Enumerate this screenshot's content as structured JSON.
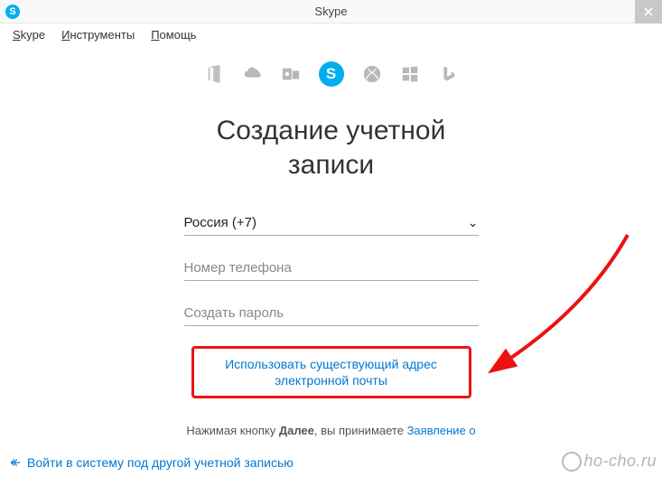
{
  "titlebar": {
    "title": "Skype",
    "icon_letter": "S"
  },
  "menubar": {
    "skype": "Skype",
    "tools": "Инструменты",
    "help": "Помощь"
  },
  "services": {
    "office": "office-icon",
    "onedrive": "onedrive-icon",
    "outlook": "outlook-icon",
    "skype_letter": "S",
    "xbox": "xbox-icon",
    "windows": "windows-icon",
    "bing": "bing-icon"
  },
  "heading_line1": "Создание учетной",
  "heading_line2": "записи",
  "form": {
    "country": "Россия (+7)",
    "phone_placeholder": "Номер телефона",
    "password_placeholder": "Создать пароль"
  },
  "use_email_line1": "Использовать существующий адрес",
  "use_email_line2": "электронной почты",
  "terms": {
    "prefix": "Нажимая кнопку ",
    "bold": "Далее",
    "middle": ", вы принимаете ",
    "link": "Заявление о"
  },
  "bottom_link": "Войти в систему под другой учетной записью",
  "watermark": "ho-cho.ru"
}
